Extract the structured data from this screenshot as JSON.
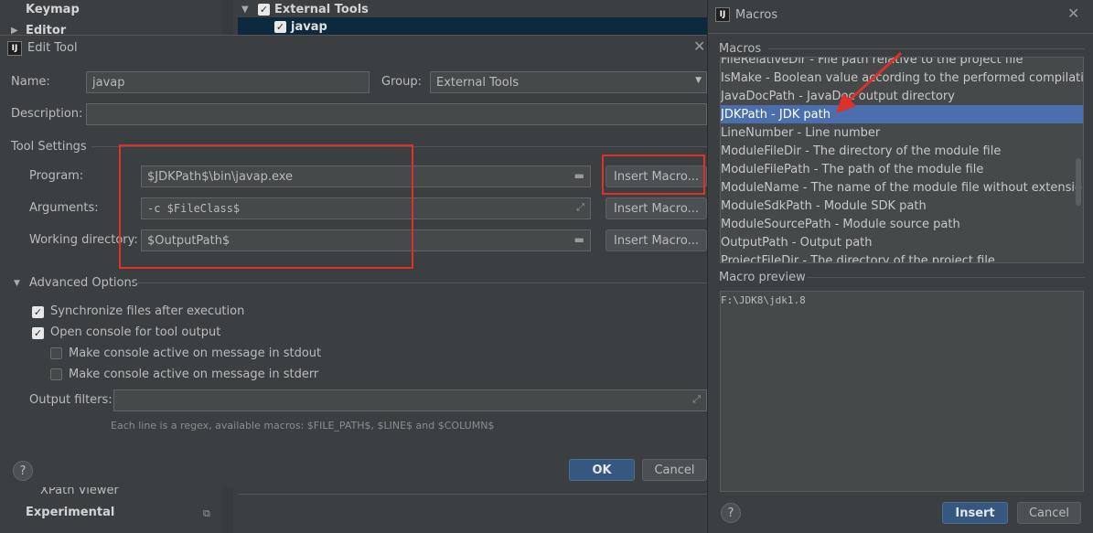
{
  "background": {
    "left_items": [
      "Keymap",
      "Editor",
      "XPath Viewer",
      "Experimental"
    ],
    "tree": [
      {
        "label": "External Tools",
        "checked": true
      },
      {
        "label": "javap",
        "checked": true
      }
    ]
  },
  "edit_tool": {
    "title": "Edit Tool",
    "name_label": "Name:",
    "name_value": "javap",
    "group_label": "Group:",
    "group_value": "External Tools",
    "description_label": "Description:",
    "description_value": "",
    "tool_settings_label": "Tool Settings",
    "program_label": "Program:",
    "program_value": "$JDKPath$\\bin\\javap.exe",
    "arguments_label": "Arguments:",
    "arguments_value": "-c $FileClass$",
    "working_dir_label": "Working directory:",
    "working_dir_value": "$OutputPath$",
    "insert_macro_label": "Insert Macro...",
    "advanced_label": "Advanced Options",
    "sync_label": "Synchronize files after execution",
    "open_console_label": "Open console for tool output",
    "stdout_label": "Make console active on message in stdout",
    "stderr_label": "Make console active on message in stderr",
    "output_filters_label": "Output filters:",
    "output_filters_value": "",
    "hint": "Each line is a regex, available macros: $FILE_PATH$, $LINE$ and $COLUMN$",
    "ok_label": "OK",
    "cancel_label": "Cancel",
    "help_label": "?"
  },
  "macros": {
    "title": "Macros",
    "section_label": "Macros",
    "items": [
      "FileRelativeDir - File path relative to the project file",
      "IsMake - Boolean value according to the performed compilation: true",
      "JavaDocPath - JavaDoc output directory",
      "JDKPath - JDK path",
      "LineNumber - Line number",
      "ModuleFileDir - The directory of the module file",
      "ModuleFilePath - The path of the module file",
      "ModuleName - The name of the module file without extension",
      "ModuleSdkPath - Module SDK path",
      "ModuleSourcePath - Module source path",
      "OutputPath - Output path",
      "ProjectFileDir - The directory of the project file"
    ],
    "selected_index": 3,
    "preview_label": "Macro preview",
    "preview_value": "F:\\JDK8\\jdk1.8",
    "insert_label": "Insert",
    "cancel_label": "Cancel",
    "help_label": "?"
  },
  "colors": {
    "background": "#3c3f41",
    "field": "#45494a",
    "selection": "#4b6eaf",
    "primary_button": "#365880",
    "annotation_red": "#e0302a"
  },
  "icons": [
    "intellij-logo-icon",
    "close-icon",
    "folder-icon",
    "expand-icon",
    "dropdown-arrow-icon",
    "checkbox-icon",
    "annotation-arrow"
  ]
}
